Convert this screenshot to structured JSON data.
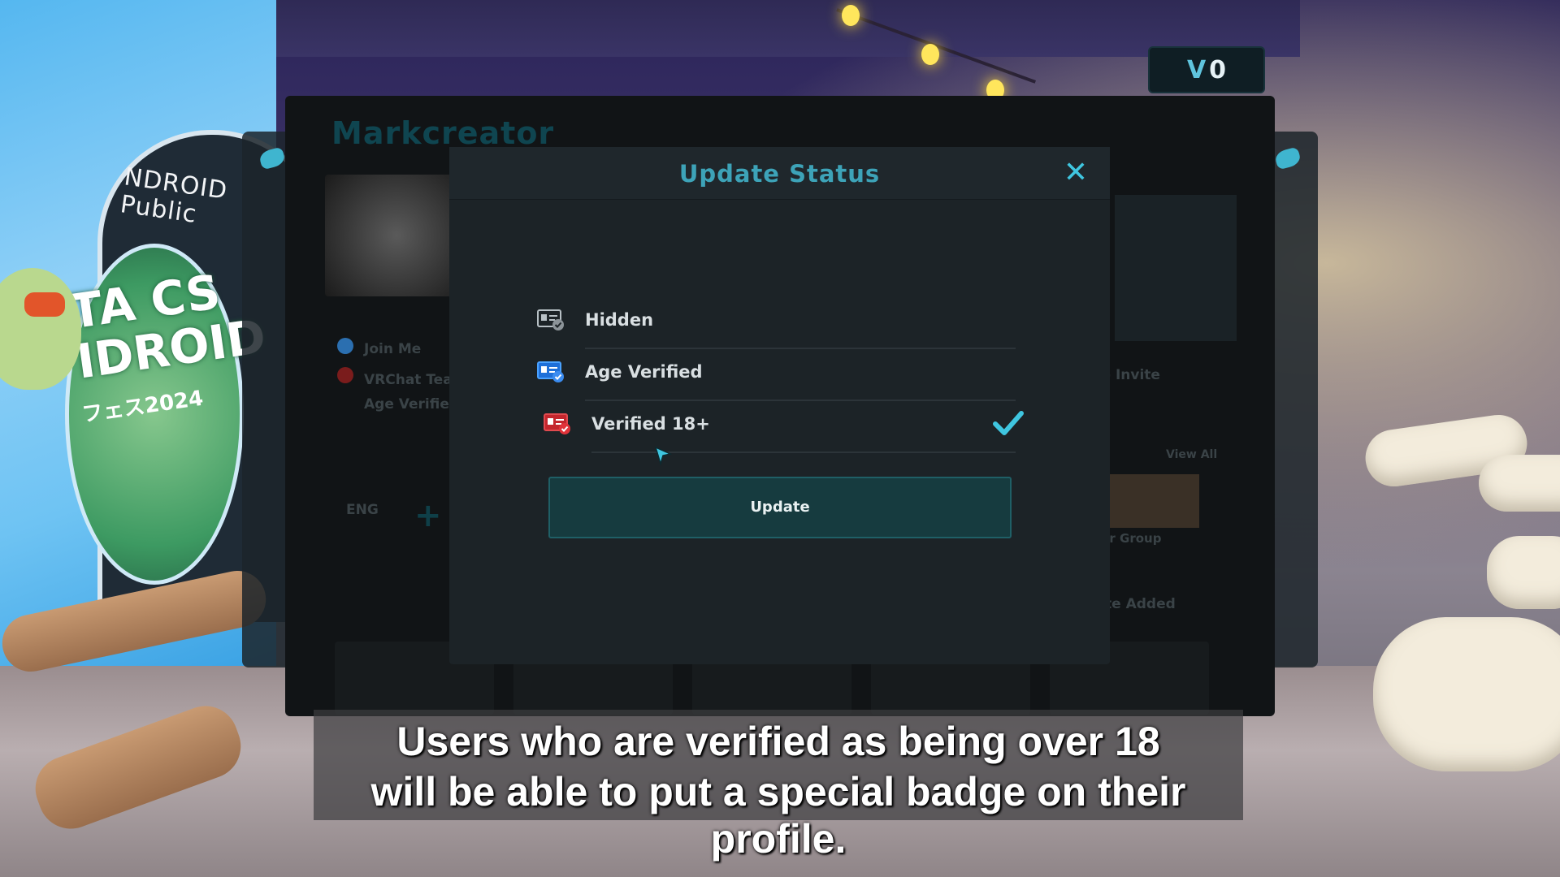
{
  "hud": {
    "currency_icon": "V",
    "currency_value": "0"
  },
  "profile_bg": {
    "name": "Markcreator",
    "status_label": "Join Me",
    "rank_label": "VRChat Tea",
    "badge_label": "Age Verifie",
    "language": "ENG",
    "right_status": "- Invite",
    "view_all": "View All",
    "group_label": "rr Group",
    "sort_label": "te Added"
  },
  "poster": {
    "caption_line1": "NDROID",
    "caption_line2": "Public",
    "big_text": "TA CS IDROID",
    "year_text": "フェス2024"
  },
  "dialog": {
    "title": "Update Status",
    "close_icon": "close-icon",
    "options": [
      {
        "label": "Hidden",
        "icon": "id-card-gray-icon",
        "selected": false
      },
      {
        "label": "Age Verified",
        "icon": "id-card-blue-icon",
        "selected": false
      },
      {
        "label": "Verified 18+",
        "icon": "id-card-red-icon",
        "selected": true
      }
    ],
    "update_label": "Update",
    "accent": "#3fc6e0"
  },
  "subtitle": {
    "line1": "Users who are verified as being over 18",
    "line2": "will be able to put a special badge on their profile."
  }
}
